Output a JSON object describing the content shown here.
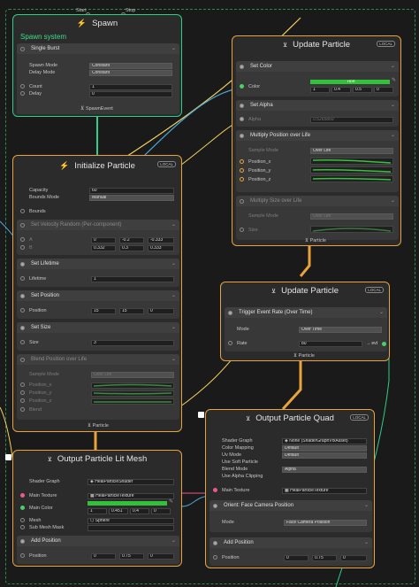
{
  "graph": {
    "start_label": "Start",
    "stop_label": "Stop",
    "spawn_event_label": "SpawnEvent",
    "particle_label": "Particle",
    "evt_label": "evt"
  },
  "spawn": {
    "title": "Spawn",
    "system_name": "Spawn system",
    "block_title": "Single Burst",
    "spawn_mode_label": "Spawn Mode",
    "spawn_mode_value": "Constant",
    "delay_mode_label": "Delay Mode",
    "delay_mode_value": "Constant",
    "count_label": "Count",
    "count_value": "1",
    "delay_label": "Delay",
    "delay_value": "0"
  },
  "init": {
    "title": "Initialize Particle",
    "badge": "LOCAL",
    "capacity_label": "Capacity",
    "capacity_value": "60",
    "bounds_mode_label": "Bounds Mode",
    "bounds_mode_value": "Manual",
    "bounds_label": "Bounds",
    "velocity_title": "Set Velocity Random (Per-component)",
    "velocity_A": {
      "label": "A",
      "x": "0",
      "y": "-0.2",
      "z": "-0.333"
    },
    "velocity_B": {
      "label": "B",
      "x": "0.332",
      "y": "0.3",
      "z": "0.333"
    },
    "lifetime_title": "Set Lifetime",
    "lifetime_label": "Lifetime",
    "lifetime_value": "1",
    "position_title": "Set Position",
    "position_label": "Position",
    "position": {
      "x": "15",
      "y": "15",
      "z": "0"
    },
    "size_title": "Set Size",
    "size_label": "Size",
    "size_value": "3",
    "blend_title": "Blend Position over Life",
    "sample_mode_label": "Sample Mode",
    "sample_mode_value": "Over Life",
    "pos_x_label": "Position_x",
    "pos_y_label": "Position_y",
    "pos_z_label": "Position_z",
    "blend_label": "Blend"
  },
  "update1": {
    "title": "Update Particle",
    "badge": "LOCAL",
    "set_color_title": "Set Color",
    "color_label": "Color",
    "color_hdr": "HDR",
    "color_values": [
      "1",
      "0.4",
      "0.5",
      "0"
    ],
    "set_alpha_title": "Set Alpha",
    "alpha_label": "Alpha",
    "alpha_value": "0.5265869",
    "multiply_pos_title": "Multiply Position over Life",
    "sample_mode_label": "Sample Mode",
    "sample_mode_value": "Over Life",
    "pos_x_label": "Position_x",
    "pos_y_label": "Position_y",
    "pos_z_label": "Position_z",
    "multiply_size_title": "Multiply Size over Life",
    "sample_mode2_label": "Sample Mode",
    "sample_mode2_value": "Over Life",
    "size_label": "Size",
    "green": "#36c23e"
  },
  "update2": {
    "title": "Update Particle",
    "badge": "LOCAL",
    "trigger_title": "Trigger Event Rate (Over Time)",
    "mode_label": "Mode",
    "mode_value": "Over Time",
    "rate_label": "Rate",
    "rate_value": "80"
  },
  "quad": {
    "title": "Output Particle Quad",
    "badge": "LOCAL",
    "shader_graph_label": "Shader Graph",
    "shader_graph_value": "None (ShaderGraphVfxAsset)",
    "color_mapping_label": "Color Mapping",
    "color_mapping_value": "Default",
    "uv_mode_label": "Uv Mode",
    "uv_mode_value": "Default",
    "soft_particle_label": "Use Soft Particle",
    "blend_mode_label": "Blend Mode",
    "blend_mode_value": "Alpha",
    "alpha_clipping_label": "Use Alpha Clipping",
    "main_texture_label": "Main Texture",
    "main_texture_value": "HealParticleTexture",
    "orient_title": "Orient: Face Camera Position",
    "mode_label": "Mode",
    "mode_value": "Face Camera Position",
    "add_position_title": "Add Position",
    "position_label": "Position",
    "position": {
      "x": "0",
      "y": "0.75",
      "z": "0"
    }
  },
  "mesh": {
    "title": "Output Particle Lit Mesh",
    "shader_graph_label": "Shader Graph",
    "shader_graph_value": "HealParticleShader",
    "main_texture_label": "Main Texture",
    "main_texture_value": "HealParticleTexture",
    "main_color_label": "Main Color",
    "main_color_values": [
      "1",
      "0.451",
      "0.4",
      "0"
    ],
    "mesh_label": "Mesh",
    "mesh_value": "Sphere",
    "submesh_label": "Sub Mesh Mask",
    "add_position_title": "Add Position",
    "position_label": "Position",
    "position": {
      "x": "0",
      "y": "0.75",
      "z": "0"
    }
  },
  "colors": {
    "orange": "#e8a33a",
    "teal": "#2ecf8a",
    "wire_yellow": "#f0d060",
    "wire_blue": "#4aa8d8",
    "wire_pink": "#e85b8a"
  }
}
